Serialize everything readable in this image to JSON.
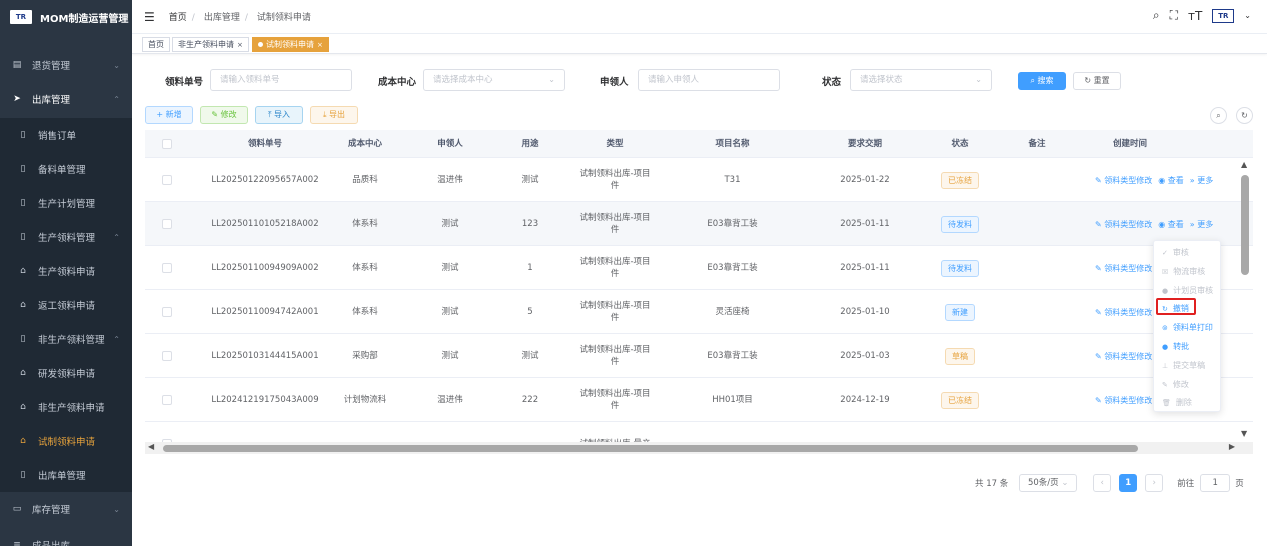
{
  "app": {
    "title": "MOM制造运营管理",
    "logo_text": "TR"
  },
  "sidebar": {
    "items": [
      {
        "label": "退货管理",
        "icon": "return-icon",
        "arrow": "⌄"
      },
      {
        "label": "出库管理",
        "icon": "send-icon",
        "arrow": "⌃"
      },
      {
        "label": "销售订单",
        "icon": "book-icon"
      },
      {
        "label": "备料单管理",
        "icon": "book-icon"
      },
      {
        "label": "生产计划管理",
        "icon": "book-icon"
      },
      {
        "label": "生产领料管理",
        "icon": "book-icon",
        "arrow": "⌃"
      },
      {
        "label": "生产领料申请",
        "icon": "tray-icon"
      },
      {
        "label": "返工领料申请",
        "icon": "tray-icon"
      },
      {
        "label": "非生产领料管理",
        "icon": "book-icon",
        "arrow": "⌃"
      },
      {
        "label": "研发领料申请",
        "icon": "tray-icon"
      },
      {
        "label": "非生产领料申请",
        "icon": "tray-icon"
      },
      {
        "label": "试制领料申请",
        "icon": "tray-icon"
      },
      {
        "label": "出库单管理",
        "icon": "book-icon"
      },
      {
        "label": "库存管理",
        "icon": "monitor-icon",
        "arrow": "⌄"
      },
      {
        "label": "成品出库",
        "icon": "list-icon",
        "arrow": "⌄"
      }
    ]
  },
  "breadcrumb": [
    "首页",
    "出库管理",
    "试制领料申请"
  ],
  "tabs": [
    {
      "label": "首页"
    },
    {
      "label": "非生产领料申请",
      "close": "×"
    },
    {
      "label": "试制领料申请",
      "close": "×"
    }
  ],
  "filters": {
    "order_no": {
      "label": "领料单号",
      "placeholder": "请输入领料单号"
    },
    "cost_center": {
      "label": "成本中心",
      "placeholder": "请选择成本中心"
    },
    "applicant": {
      "label": "申领人",
      "placeholder": "请输入申领人"
    },
    "status": {
      "label": "状态",
      "placeholder": "请选择状态"
    },
    "search_label": "搜索",
    "reset_label": "重置"
  },
  "toolbar": {
    "add": "新增",
    "edit": "修改",
    "import": "导入",
    "export": "导出"
  },
  "table": {
    "headers": [
      "领料单号",
      "成本中心",
      "申领人",
      "用途",
      "类型",
      "项目名称",
      "要求交期",
      "状态",
      "备注",
      "创建时间"
    ],
    "rows": [
      {
        "no": "LL20250122095657A002",
        "cost": "品质科",
        "applicant": "温进伟",
        "use": "测试",
        "type": "试制领料出库-项目件",
        "project": "T31",
        "date": "2025-01-22",
        "status": "已冻结",
        "status_class": "st-frozen"
      },
      {
        "no": "LL20250110105218A002",
        "cost": "体系科",
        "applicant": "测试",
        "use": "123",
        "type": "试制领料出库-项目件",
        "project": "E03靠背工装",
        "date": "2025-01-11",
        "status": "待发料",
        "status_class": "st-pending"
      },
      {
        "no": "LL20250110094909A002",
        "cost": "体系科",
        "applicant": "测试",
        "use": "1",
        "type": "试制领料出库-项目件",
        "project": "E03靠背工装",
        "date": "2025-01-11",
        "status": "待发料",
        "status_class": "st-pending"
      },
      {
        "no": "LL20250110094742A001",
        "cost": "体系科",
        "applicant": "测试",
        "use": "5",
        "type": "试制领料出库-项目件",
        "project": "灵活座椅",
        "date": "2025-01-10",
        "status": "新建",
        "status_class": "st-new"
      },
      {
        "no": "LL20250103144415A001",
        "cost": "采购部",
        "applicant": "测试",
        "use": "测试",
        "type": "试制领料出库-项目件",
        "project": "E03靠背工装",
        "date": "2025-01-03",
        "status": "草稿",
        "status_class": "st-draft"
      },
      {
        "no": "LL20241219175043A009",
        "cost": "计划物流科",
        "applicant": "温进伟",
        "use": "222",
        "type": "试制领料出库-项目件",
        "project": "HH01项目",
        "date": "2024-12-19",
        "status": "已冻结",
        "status_class": "st-frozen"
      },
      {
        "no": "",
        "cost": "",
        "applicant": "",
        "use": "",
        "type": "试制领料出库-量产",
        "project": "",
        "date": "",
        "status": "",
        "status_class": ""
      }
    ],
    "ops": {
      "type_edit": "领料类型修改",
      "view": "查看",
      "more": "更多"
    }
  },
  "dropdown": [
    {
      "label": "审核",
      "icon": "✓",
      "enabled": false
    },
    {
      "label": "物流审核",
      "icon": "☒",
      "enabled": false
    },
    {
      "label": "计划员审核",
      "icon": "●",
      "enabled": false
    },
    {
      "label": "撤销",
      "icon": "↻",
      "enabled": true
    },
    {
      "label": "领料单打印",
      "icon": "⊚",
      "enabled": true
    },
    {
      "label": "转批",
      "icon": "●",
      "enabled": true
    },
    {
      "label": "提交草稿",
      "icon": "⊥",
      "enabled": false
    },
    {
      "label": "修改",
      "icon": "✎",
      "enabled": false
    },
    {
      "label": "删除",
      "icon": "🗑",
      "enabled": false
    }
  ],
  "pagination": {
    "total": "共 17 条",
    "page_size": "50条/页",
    "current": "1",
    "goto_label": "前往",
    "goto_value": "1",
    "page_unit": "页"
  },
  "colors": {
    "sidebar_bg": "#2b3643",
    "accent": "#e6a23c",
    "primary": "#409eff",
    "highlight": "#e02020"
  }
}
